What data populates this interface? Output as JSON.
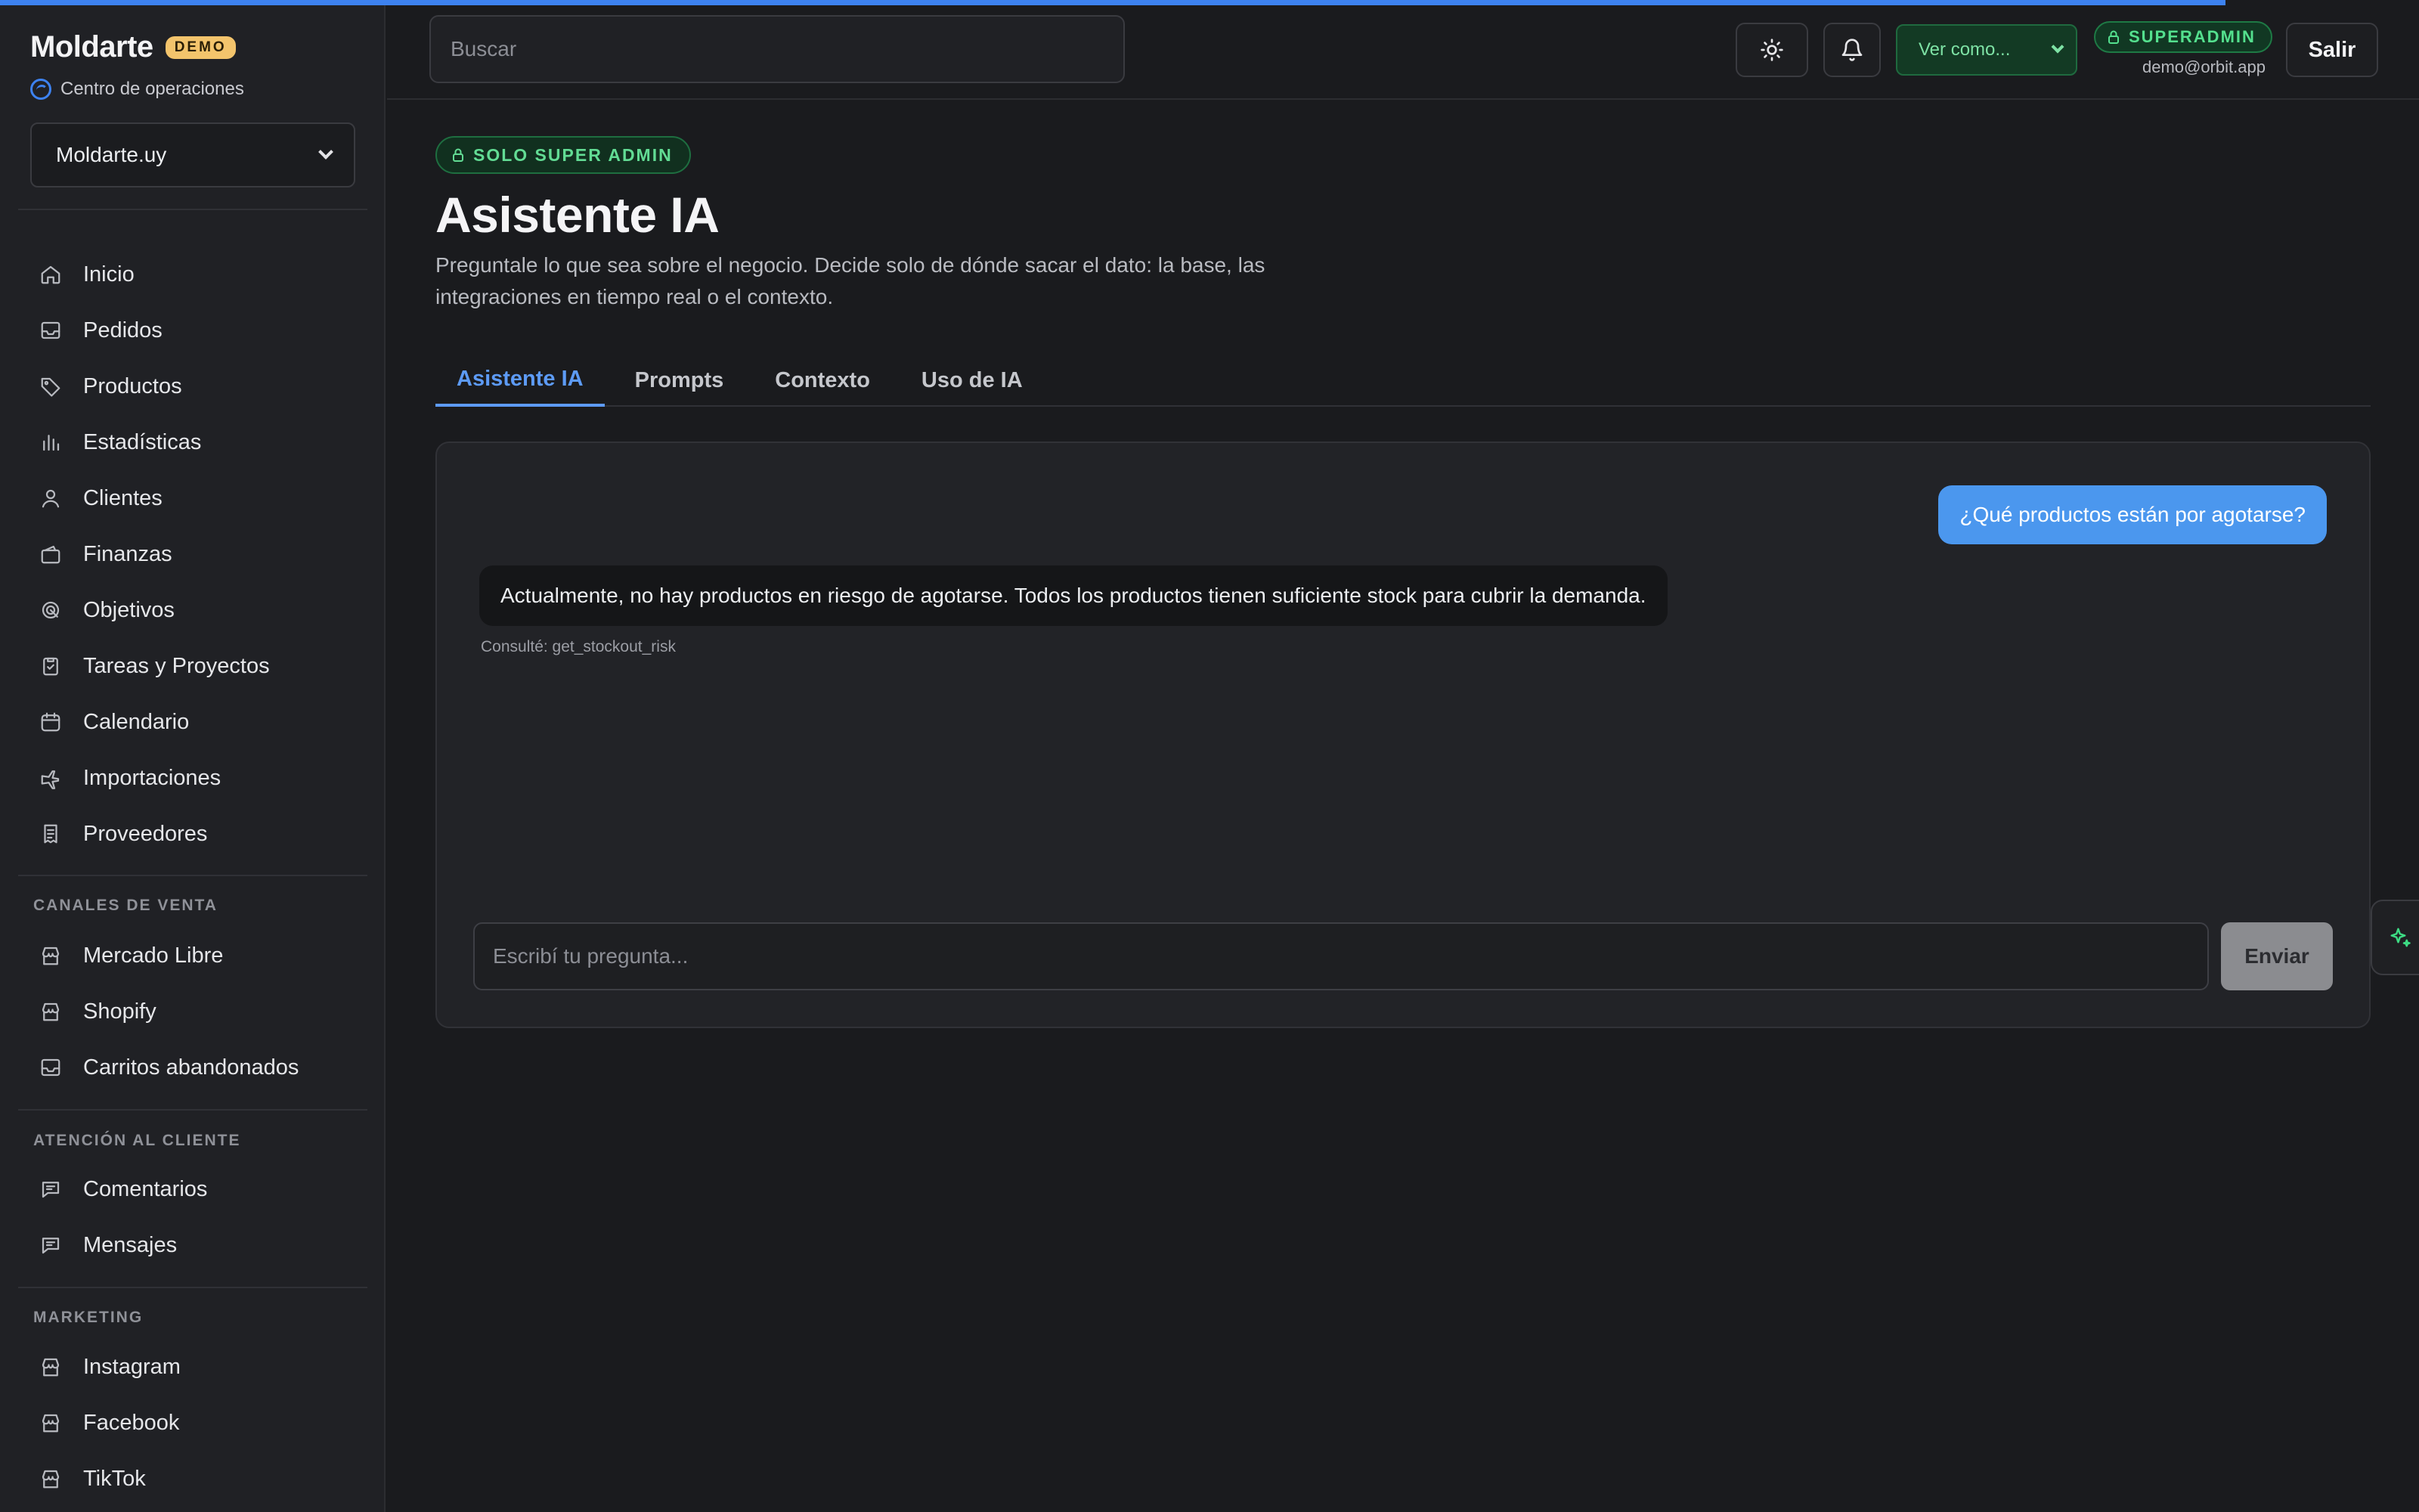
{
  "page_load_progress": 0.92,
  "brand": {
    "name": "Moldarte",
    "badge": "DEMO",
    "subtitle": "Centro de operaciones"
  },
  "store_selector": {
    "value": "Moldarte.uy"
  },
  "sidebar": {
    "main_items": [
      {
        "label": "Inicio",
        "icon": "home-icon"
      },
      {
        "label": "Pedidos",
        "icon": "inbox-icon"
      },
      {
        "label": "Productos",
        "icon": "tag-icon"
      },
      {
        "label": "Estadísticas",
        "icon": "bar-chart-icon"
      },
      {
        "label": "Clientes",
        "icon": "user-icon"
      },
      {
        "label": "Finanzas",
        "icon": "wallet-icon"
      },
      {
        "label": "Objetivos",
        "icon": "target-icon"
      },
      {
        "label": "Tareas y Proyectos",
        "icon": "clipboard-icon"
      },
      {
        "label": "Calendario",
        "icon": "calendar-icon"
      },
      {
        "label": "Importaciones",
        "icon": "plane-icon"
      },
      {
        "label": "Proveedores",
        "icon": "receipt-icon"
      }
    ],
    "sections": [
      {
        "title": "CANALES DE VENTA",
        "items": [
          {
            "label": "Mercado Libre",
            "icon": "store-icon"
          },
          {
            "label": "Shopify",
            "icon": "store-icon"
          },
          {
            "label": "Carritos abandonados",
            "icon": "inbox-icon"
          }
        ]
      },
      {
        "title": "ATENCIÓN AL CLIENTE",
        "items": [
          {
            "label": "Comentarios",
            "icon": "chat-icon"
          },
          {
            "label": "Mensajes",
            "icon": "chat-icon"
          }
        ]
      },
      {
        "title": "MARKETING",
        "items": [
          {
            "label": "Instagram",
            "icon": "store-icon"
          },
          {
            "label": "Facebook",
            "icon": "store-icon"
          },
          {
            "label": "TikTok",
            "icon": "store-icon"
          }
        ]
      }
    ]
  },
  "topbar": {
    "search_placeholder": "Buscar",
    "view_as": "Ver como...",
    "role_badge": "SUPERADMIN",
    "email": "demo@orbit.app",
    "logout_label": "Salir"
  },
  "main": {
    "access_badge": "SOLO SUPER ADMIN",
    "title": "Asistente IA",
    "description": "Preguntale lo que sea sobre el negocio. Decide solo de dónde sacar el dato: la base, las integraciones en tiempo real o el contexto.",
    "tabs": [
      {
        "label": "Asistente IA",
        "active": true
      },
      {
        "label": "Prompts",
        "active": false
      },
      {
        "label": "Contexto",
        "active": false
      },
      {
        "label": "Uso de IA",
        "active": false
      }
    ]
  },
  "chat": {
    "messages": [
      {
        "role": "user",
        "text": "¿Qué productos están por agotarse?"
      },
      {
        "role": "assistant",
        "text": "Actualmente, no hay productos en riesgo de agotarse. Todos los productos tienen suficiente stock para cubrir la demanda.",
        "tool_note": "Consulté: get_stockout_risk"
      }
    ],
    "input_placeholder": "Escribí tu pregunta...",
    "send_label": "Enviar"
  },
  "colors": {
    "accent": "#3d82f0",
    "user_bubble": "#4b97ee",
    "success": "#54e08e",
    "demo_badge": "#f3c46c"
  }
}
